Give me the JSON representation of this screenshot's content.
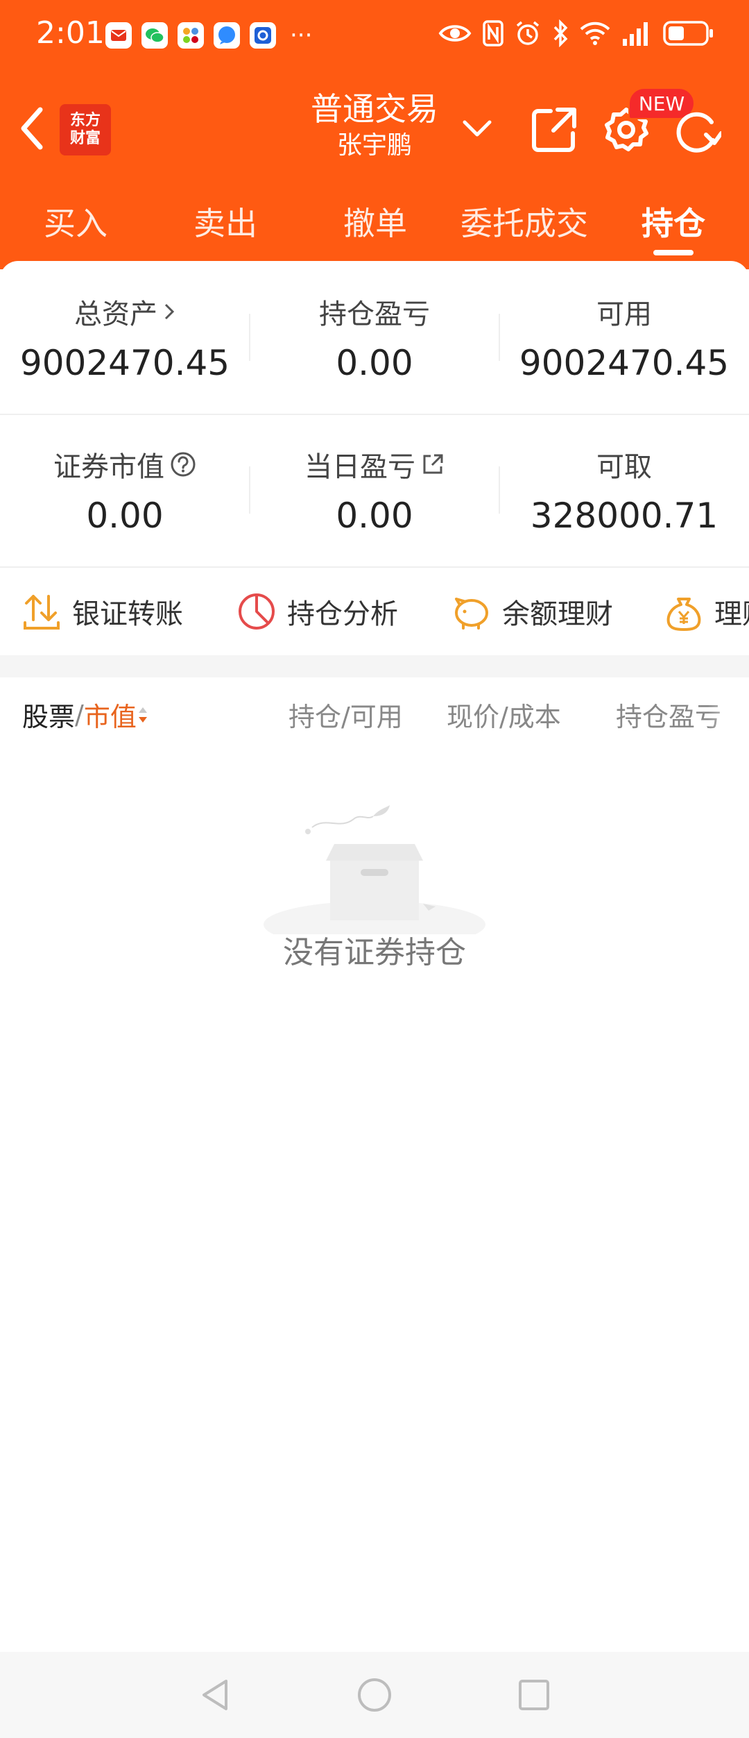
{
  "status_bar": {
    "time": "2:01",
    "more": "···",
    "notification_icons": [
      "mail-app-icon",
      "wechat-icon",
      "apps-icon",
      "message-icon",
      "browser-icon"
    ],
    "system_icons": [
      "eye-icon",
      "nfc-icon",
      "alarm-icon",
      "bluetooth-icon",
      "wifi-icon",
      "signal-icon",
      "battery-icon"
    ]
  },
  "header": {
    "logo_line1": "东方",
    "logo_line2": "财富",
    "title": "普通交易",
    "subtitle": "张宇鹏",
    "new_badge": "NEW"
  },
  "tabs": [
    {
      "label": "买入"
    },
    {
      "label": "卖出"
    },
    {
      "label": "撤单"
    },
    {
      "label": "委托成交"
    },
    {
      "label": "持仓",
      "active": true
    }
  ],
  "stats": {
    "total_assets_label": "总资产",
    "total_assets_value": "9002470.45",
    "position_pnl_label": "持仓盈亏",
    "position_pnl_value": "0.00",
    "available_label": "可用",
    "available_value": "9002470.45",
    "market_value_label": "证券市值",
    "market_value_value": "0.00",
    "daily_pnl_label": "当日盈亏",
    "daily_pnl_value": "0.00",
    "withdrawable_label": "可取",
    "withdrawable_value": "328000.71"
  },
  "actions": [
    {
      "label": "银证转账"
    },
    {
      "label": "持仓分析"
    },
    {
      "label": "余额理财"
    },
    {
      "label": "理财"
    }
  ],
  "table": {
    "col1_a": "股票",
    "col1_sep": "/",
    "col1_b": "市值",
    "col2": "持仓/可用",
    "col3": "现价/成本",
    "col4": "持仓盈亏"
  },
  "empty_state": {
    "message": "没有证券持仓"
  },
  "colors": {
    "brand": "#FF5A12",
    "accent_text": "#E8641E",
    "badge": "#F52A2A"
  }
}
